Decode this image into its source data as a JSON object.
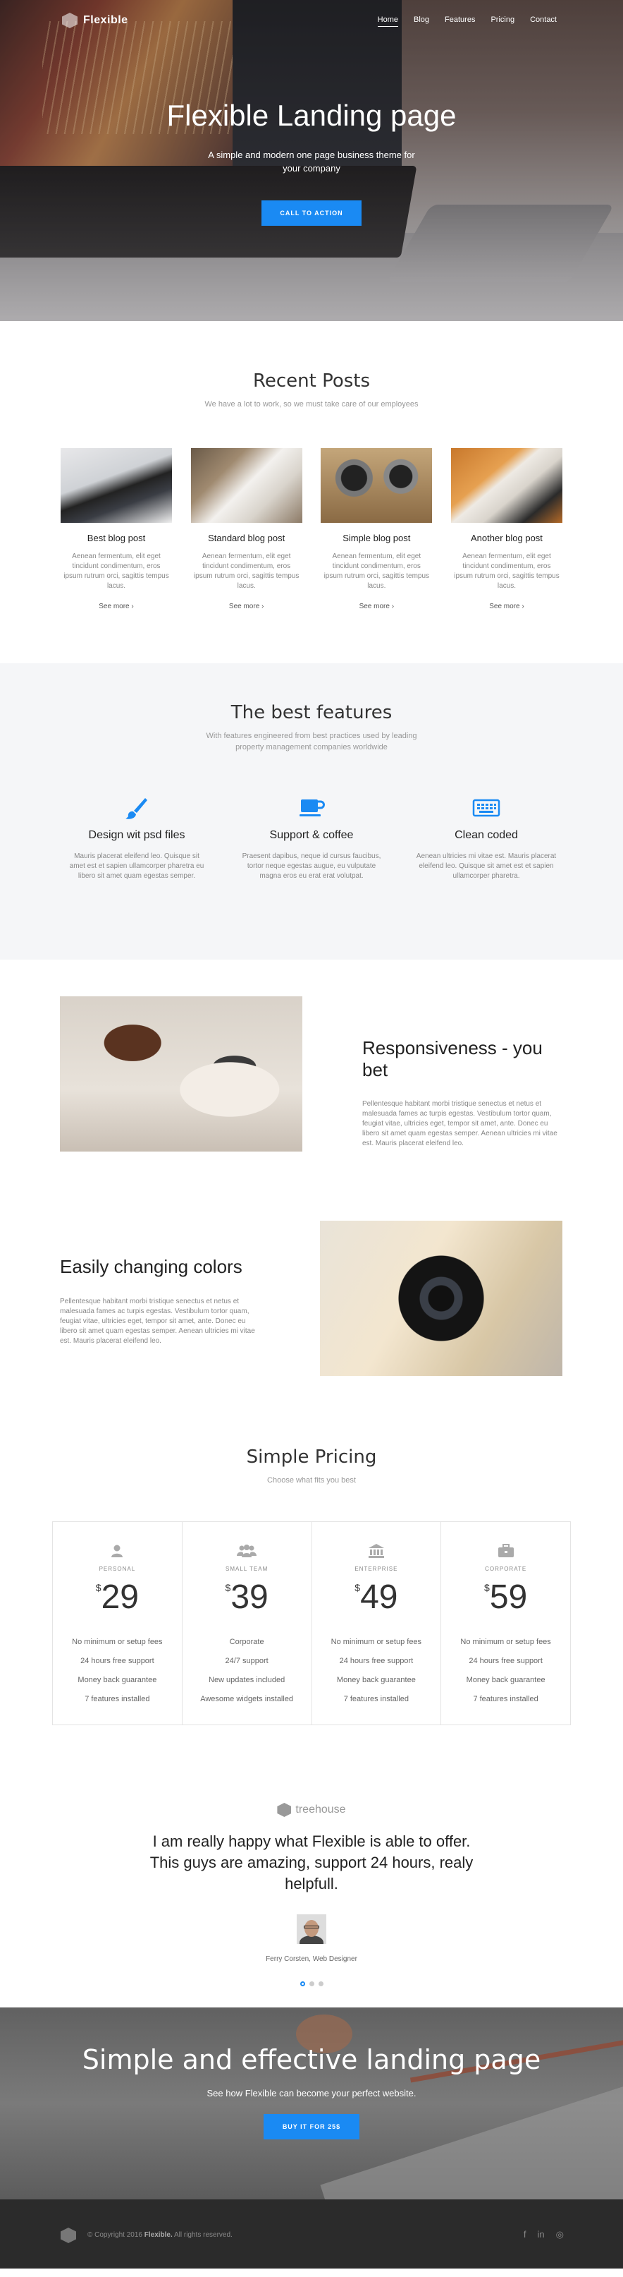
{
  "nav": {
    "brand": "Flexible",
    "links": [
      "Home",
      "Blog",
      "Features",
      "Pricing",
      "Contact"
    ],
    "active": "Home"
  },
  "hero": {
    "title": "Flexible Landing page",
    "subtitle": "A simple and modern one page business theme for your company",
    "button": "CALL TO ACTION"
  },
  "posts": {
    "title": "Recent Posts",
    "subtitle": "We have a lot to work, so we must take care of our employees",
    "items": [
      {
        "title": "Best blog post",
        "text": "Aenean fermentum, elit eget tincidunt condimentum, eros ipsum rutrum orci, sagittis tempus lacus.",
        "more": "See more"
      },
      {
        "title": "Standard blog post",
        "text": "Aenean fermentum, elit eget tincidunt condimentum, eros ipsum rutrum orci, sagittis tempus lacus.",
        "more": "See more"
      },
      {
        "title": "Simple blog post",
        "text": "Aenean fermentum, elit eget tincidunt condimentum, eros ipsum rutrum orci, sagittis tempus lacus.",
        "more": "See more"
      },
      {
        "title": "Another blog post",
        "text": "Aenean fermentum, elit eget tincidunt condimentum, eros ipsum rutrum orci, sagittis tempus lacus.",
        "more": "See more"
      }
    ]
  },
  "features": {
    "title": "The best features",
    "subtitle": "With features engineered from best practices used by leading property management companies worldwide",
    "items": [
      {
        "icon": "brush-icon",
        "title": "Design wit psd files",
        "text": "Mauris placerat eleifend leo. Quisque sit amet est et sapien ullamcorper pharetra eu libero sit amet quam egestas semper."
      },
      {
        "icon": "coffee-icon",
        "title": "Support & coffee",
        "text": "Praesent dapibus, neque id cursus faucibus, tortor neque egestas augue, eu vulputate magna eros eu erat erat volutpat."
      },
      {
        "icon": "keyboard-icon",
        "title": "Clean coded",
        "text": "Aenean ultricies mi vitae est. Mauris placerat eleifend leo. Quisque sit amet est et sapien ullamcorper pharetra."
      }
    ]
  },
  "responsive": {
    "title": "Responsiveness - you bet",
    "text": "Pellentesque habitant morbi tristique senectus et netus et malesuada fames ac turpis egestas. Vestibulum tortor quam, feugiat vitae, ultricies eget, tempor sit amet, ante. Donec eu libero sit amet quam egestas semper. Aenean ultricies mi vitae est. Mauris placerat eleifend leo."
  },
  "colors": {
    "title": "Easily changing colors",
    "text": "Pellentesque habitant morbi tristique senectus et netus et malesuada fames ac turpis egestas. Vestibulum tortor quam, feugiat vitae, ultricies eget, tempor sit amet, ante. Donec eu libero sit amet quam egestas semper. Aenean ultricies mi vitae est. Mauris placerat eleifend leo."
  },
  "pricing": {
    "title": "Simple Pricing",
    "subtitle": "Choose what fits you best",
    "currency": "$",
    "plans": [
      {
        "icon": "user-icon",
        "name": "PERSONAL",
        "price": "29",
        "features": [
          "No minimum or setup fees",
          "24 hours free support",
          "Money back guarantee",
          "7 features installed"
        ]
      },
      {
        "icon": "team-icon",
        "name": "SMALL TEAM",
        "price": "39",
        "features": [
          "Corporate",
          "24/7 support",
          "New updates included",
          "Awesome widgets installed"
        ]
      },
      {
        "icon": "bank-icon",
        "name": "ENTERPRISE",
        "price": "49",
        "features": [
          "No minimum or setup fees",
          "24 hours free support",
          "Money back guarantee",
          "7 features installed"
        ]
      },
      {
        "icon": "briefcase-icon",
        "name": "CORPORATE",
        "price": "59",
        "features": [
          "No minimum or setup fees",
          "24 hours free support",
          "Money back guarantee",
          "7 features installed"
        ]
      }
    ]
  },
  "testimonial": {
    "logo": "treehouse",
    "quote": "I am really happy what Flexible is able to offer. This guys are amazing, support 24 hours, realy helpfull.",
    "author": "Ferry Corsten, Web Designer"
  },
  "cta": {
    "title": "Simple and effective landing page",
    "subtitle": "See how Flexible can become your perfect website.",
    "button": "BUY IT FOR 25$"
  },
  "footer": {
    "prefix": "© Copyright 2016 ",
    "brand": "Flexible.",
    "suffix": " All rights reserved.",
    "social": [
      "f",
      "in",
      "◎"
    ]
  },
  "accent": "#1a8af3"
}
